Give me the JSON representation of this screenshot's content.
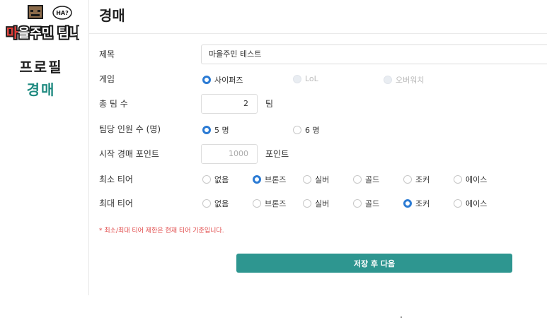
{
  "logo": {
    "text": "마을주민 팀나눠",
    "bubble": "HA?"
  },
  "sidebar": {
    "items": [
      {
        "label": "프로필"
      },
      {
        "label": "경매"
      }
    ]
  },
  "page": {
    "title": "경매"
  },
  "form": {
    "title": {
      "label": "제목",
      "value": "마을주민 테스트"
    },
    "game": {
      "label": "게임",
      "options": [
        "사이퍼즈",
        "LoL",
        "오버워치"
      ],
      "selected": "사이퍼즈",
      "disabled": [
        "LoL",
        "오버워치"
      ]
    },
    "team_count": {
      "label": "총 팀 수",
      "value": "2",
      "suffix": "팀"
    },
    "team_size": {
      "label": "팀당 인원 수 (명)",
      "options": [
        "5 명",
        "6 명"
      ],
      "selected": "5 명"
    },
    "start_points": {
      "label": "시작 경매 포인트",
      "value": "1000",
      "suffix": "포인트"
    },
    "min_tier": {
      "label": "최소 티어",
      "options": [
        "없음",
        "브론즈",
        "실버",
        "골드",
        "조커",
        "에이스"
      ],
      "selected": "브론즈"
    },
    "max_tier": {
      "label": "최대 티어",
      "options": [
        "없음",
        "브론즈",
        "실버",
        "골드",
        "조커",
        "에이스"
      ],
      "selected": "조커"
    },
    "note": "* 최소/최대 티어 제한은 현재 티어 기준입니다.",
    "submit_label": "저장 후 다음"
  },
  "colors": {
    "accent": "#2e9690",
    "nav_active": "#1f8a80",
    "radio_checked": "#2b7bd4",
    "note": "#e04848"
  }
}
